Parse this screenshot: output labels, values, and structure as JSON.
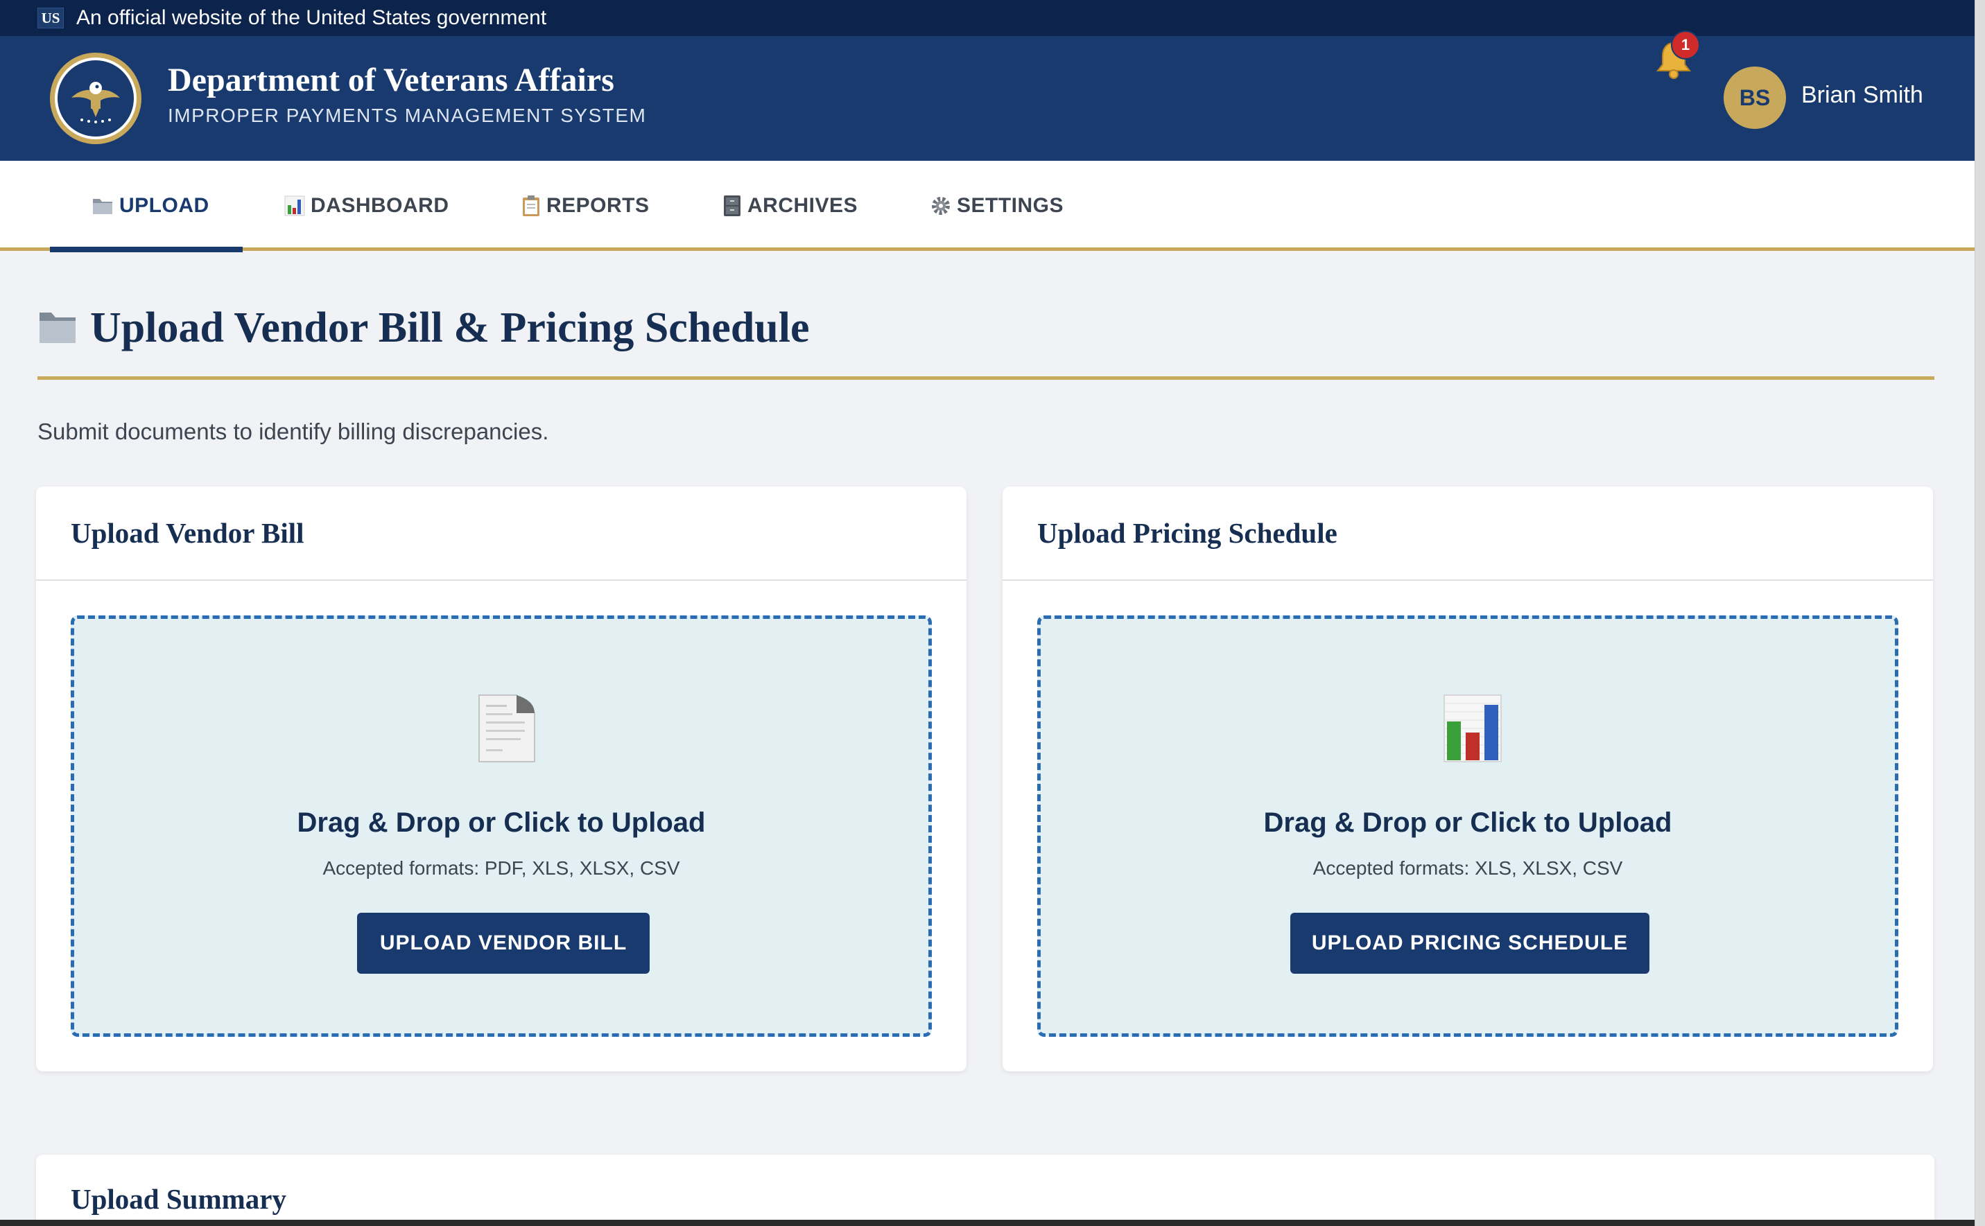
{
  "gov_banner": {
    "flag_label": "US",
    "text": "An official website of the United States government"
  },
  "header": {
    "title": "Department of Veterans Affairs",
    "subtitle": "IMPROPER PAYMENTS MANAGEMENT SYSTEM",
    "notification_count": "1",
    "user_initials": "BS",
    "user_name": "Brian Smith"
  },
  "nav": {
    "active_tab": "UPLOAD",
    "tabs": [
      {
        "label": "UPLOAD",
        "icon": "folder-icon"
      },
      {
        "label": "DASHBOARD",
        "icon": "bar-chart-icon"
      },
      {
        "label": "REPORTS",
        "icon": "clipboard-icon"
      },
      {
        "label": "ARCHIVES",
        "icon": "file-cabinet-icon"
      },
      {
        "label": "SETTINGS",
        "icon": "gear-icon"
      }
    ]
  },
  "page": {
    "title": "Upload Vendor Bill & Pricing Schedule",
    "title_icon": "folder-icon",
    "subtitle": "Submit documents to identify billing discrepancies."
  },
  "cards": [
    {
      "title": "Upload Vendor Bill",
      "icon": "document-icon",
      "heading": "Drag & Drop or Click to Upload",
      "formats": "Accepted formats: PDF, XLS, XLSX, CSV",
      "button": "UPLOAD VENDOR BILL"
    },
    {
      "title": "Upload Pricing Schedule",
      "icon": "bar-chart-icon",
      "heading": "Drag & Drop or Click to Upload",
      "formats": "Accepted formats: XLS, XLSX, CSV",
      "button": "UPLOAD PRICING SCHEDULE"
    }
  ],
  "summary": {
    "title": "Upload Summary"
  },
  "colors": {
    "navy": "#183a6e",
    "gold": "#c8a85a",
    "banner": "#0c244c",
    "dropzone_bg": "#e2f0f4",
    "dropzone_border": "#2a6bb2",
    "badge_red": "#cf2b2b"
  }
}
